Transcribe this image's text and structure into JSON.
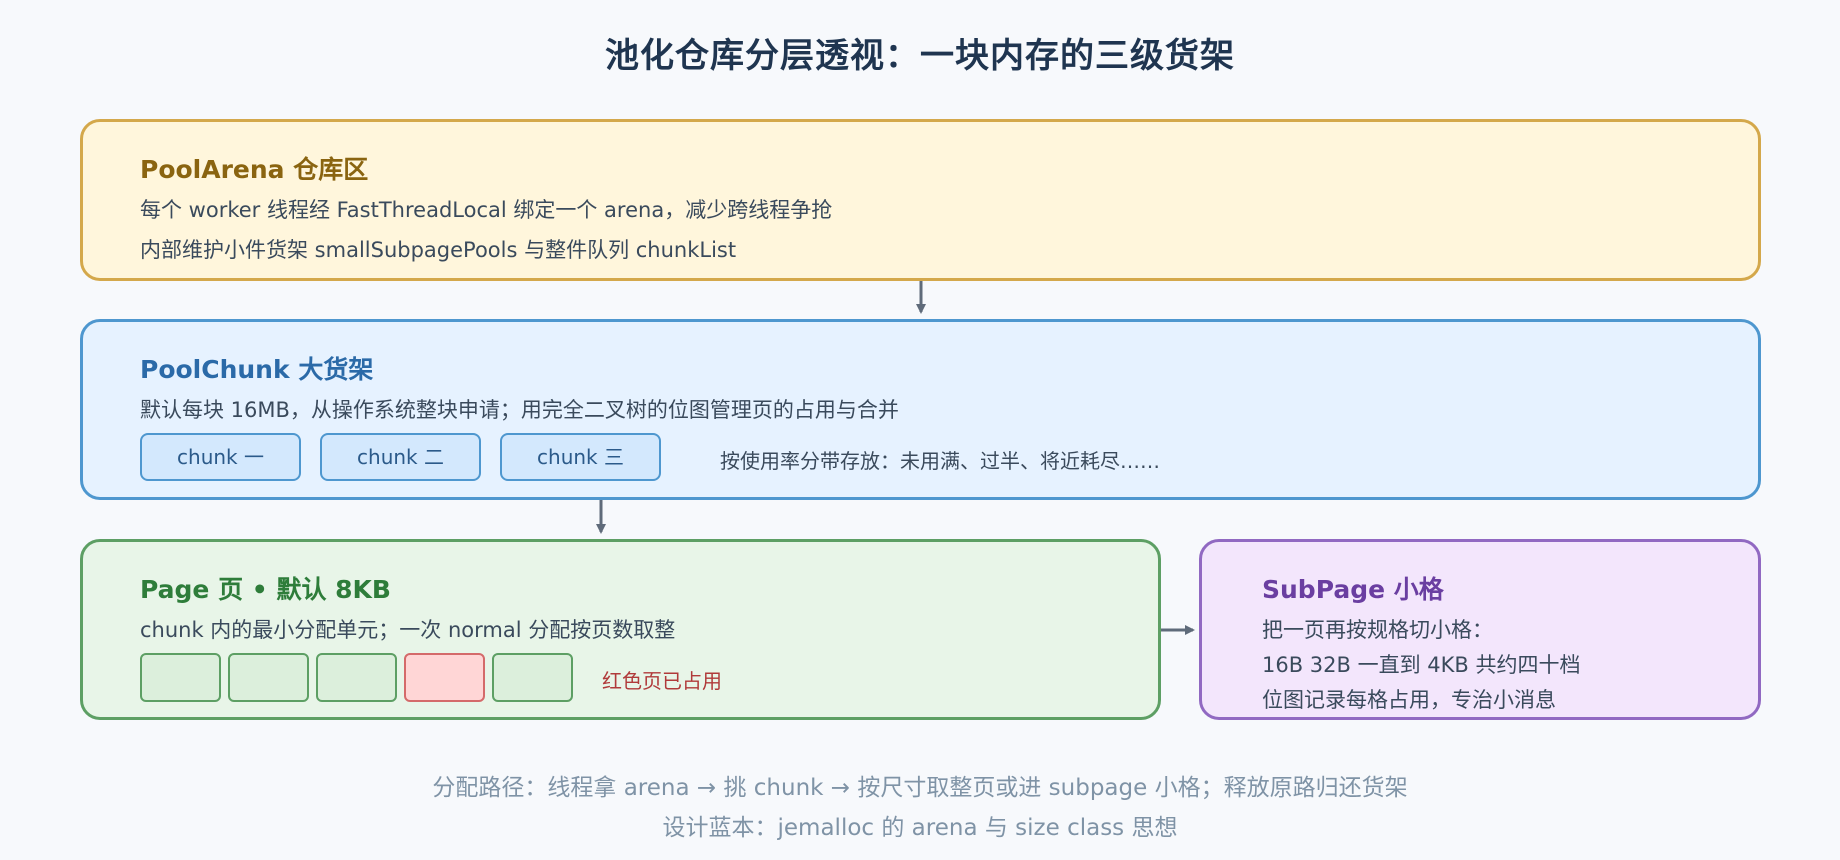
{
  "title": "池化仓库分层透视：一块内存的三级货架",
  "arena": {
    "title": "PoolArena 仓库区",
    "lines": [
      "每个 worker 线程经 FastThreadLocal 绑定一个 arena，减少跨线程争抢",
      "内部维护小件货架 smallSubpagePools 与整件队列 chunkList"
    ]
  },
  "chunk": {
    "title": "PoolChunk 大货架",
    "line": "默认每块 16MB，从操作系统整块申请；用完全二叉树的位图管理页的占用与合并",
    "chips": [
      "chunk 一",
      "chunk 二",
      "chunk 三"
    ],
    "note": "按使用率分带存放：未用满、过半、将近耗尽……"
  },
  "page": {
    "title": "Page 页 • 默认 8KB",
    "line": "chunk 内的最小分配单元；一次 normal 分配按页数取整",
    "cells": [
      false,
      false,
      false,
      true,
      false
    ],
    "note": "红色页已占用"
  },
  "subpage": {
    "title": "SubPage 小格",
    "lines": [
      "把一页再按规格切小格：",
      "16B 32B 一直到 4KB 共约四十档",
      "位图记录每格占用，专治小消息"
    ]
  },
  "footer": {
    "line1": "分配路径：线程拿 arena → 挑 chunk → 按尺寸取整页或进 subpage 小格；释放原路归还货架",
    "line2": "设计蓝本：jemalloc 的 arena 与 size class 思想"
  },
  "colors": {
    "arena_bg": "#fff6dc",
    "arena_border": "#d4a84b",
    "chunk_bg": "#e6f2ff",
    "chunk_border": "#4e97cf",
    "page_bg": "#e8f5e8",
    "page_border": "#5d9f64",
    "subpage_bg": "#f3e6fc",
    "subpage_border": "#9169c2",
    "used_page": "#ffd6d6",
    "note_red": "#b03a3a",
    "arrow": "#5f6b7a"
  }
}
